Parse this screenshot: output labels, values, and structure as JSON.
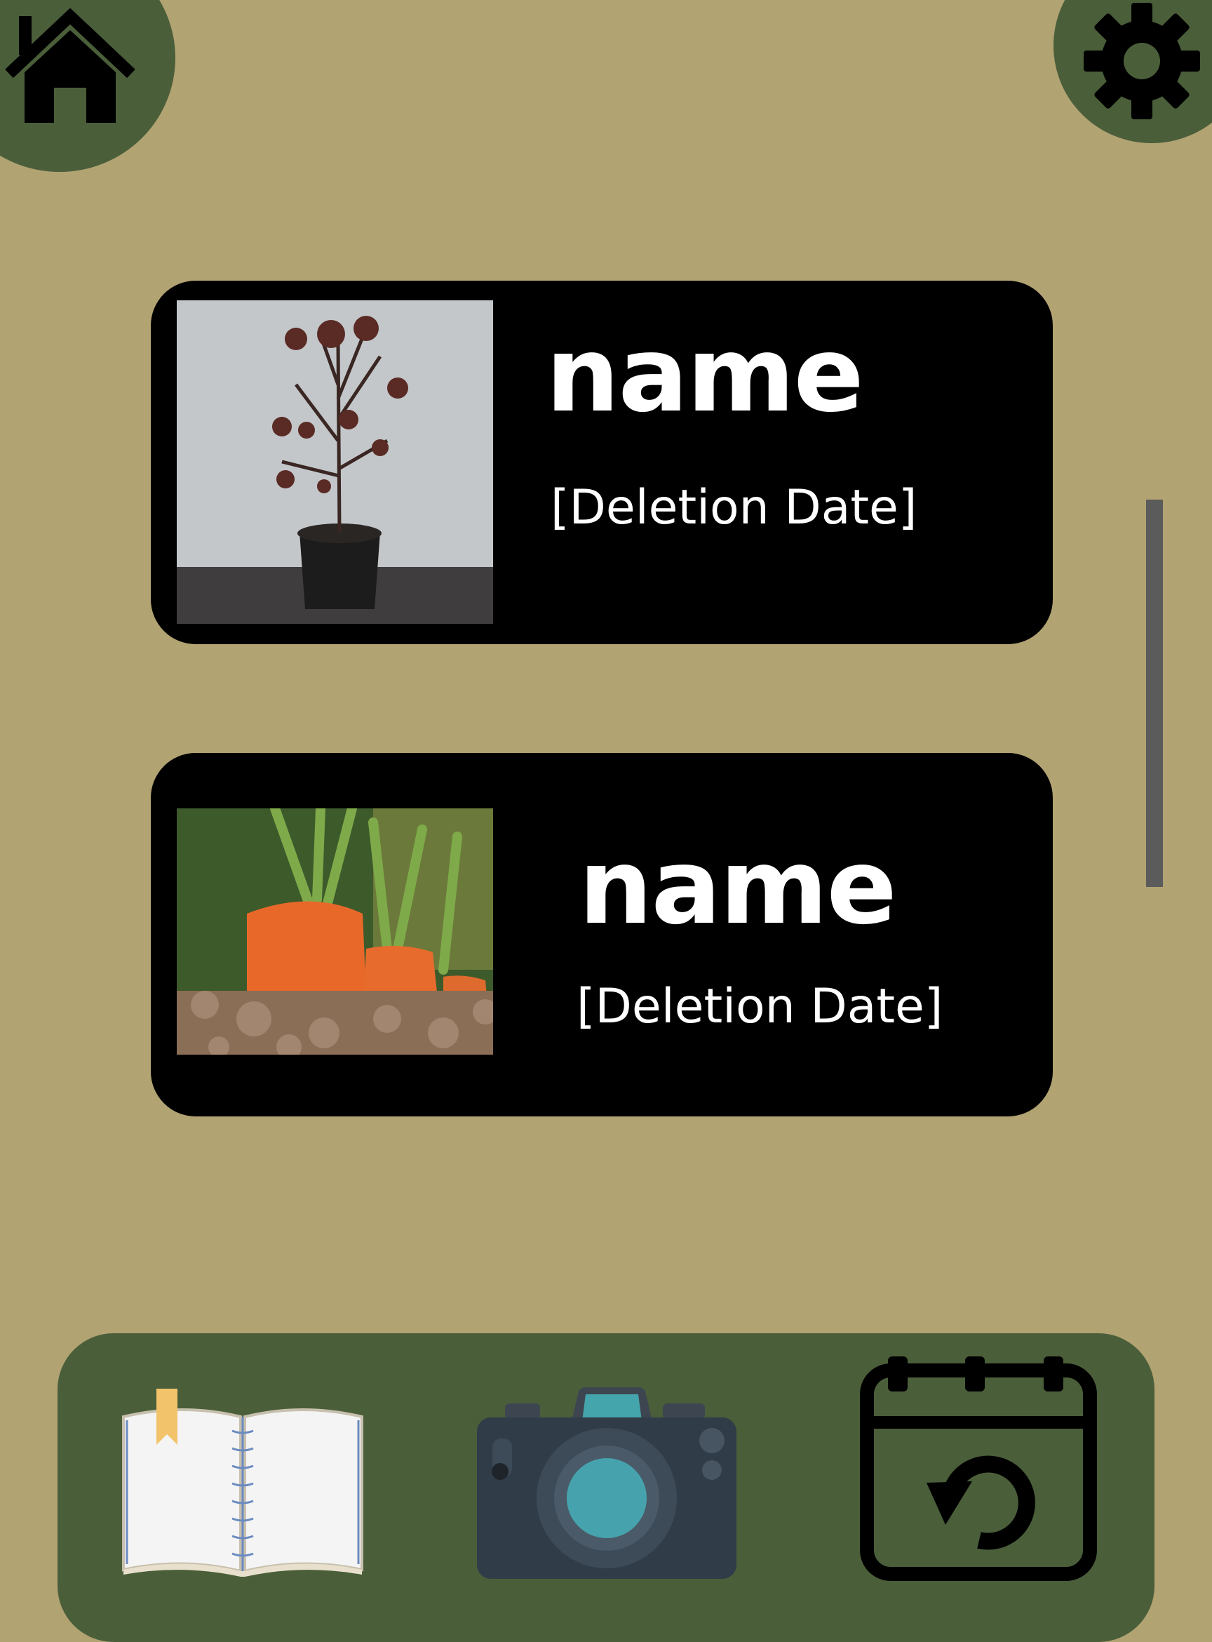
{
  "header": {
    "home_icon": "home-icon",
    "settings_icon": "gear-icon"
  },
  "cards": [
    {
      "name": "name",
      "date": "[Deletion Date]",
      "image": "wilted potted plant photo"
    },
    {
      "name": "name",
      "date": "[Deletion Date]",
      "image": "carrots in soil photo"
    }
  ],
  "bottom_nav": {
    "items": [
      {
        "icon": "open-book-icon"
      },
      {
        "icon": "camera-icon"
      },
      {
        "icon": "calendar-restore-icon"
      }
    ]
  },
  "colors": {
    "background": "#b2a373",
    "accent_green": "#4a5e3a",
    "card": "#000000",
    "scrollbar": "#5b5b5b"
  }
}
